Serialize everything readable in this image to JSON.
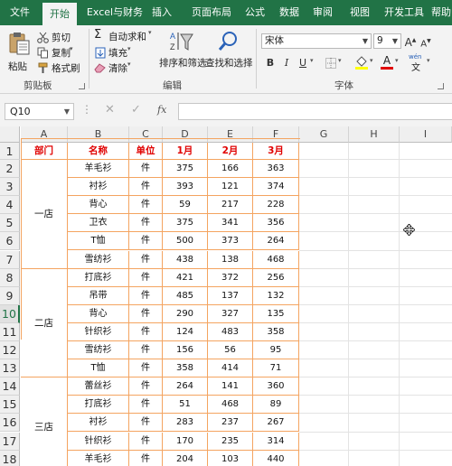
{
  "tabs": [
    "文件",
    "开始",
    "Excel与财务",
    "插入",
    "页面布局",
    "公式",
    "数据",
    "审阅",
    "视图",
    "开发工具",
    "帮助"
  ],
  "clipboard": {
    "paste": "粘贴",
    "cut": "剪切",
    "copy": "复制",
    "format_painter": "格式刷",
    "label": "剪贴板"
  },
  "editing": {
    "autosum": "自动求和",
    "fill": "填充",
    "clear": "清除",
    "sort_filter": "排序和筛选",
    "find_select": "查找和选择",
    "label": "编辑"
  },
  "font": {
    "name": "宋体",
    "size": "9",
    "bold": "B",
    "italic": "I",
    "underline": "U",
    "grow": "A",
    "shrink": "A",
    "font_color_letter": "A",
    "phonetic": "wén",
    "label": "字体"
  },
  "formula_bar": {
    "name_box": "Q10",
    "fx": "fx",
    "value": ""
  },
  "columns": [
    "A",
    "B",
    "C",
    "D",
    "E",
    "F",
    "G",
    "H",
    "I"
  ],
  "row_numbers": [
    "1",
    "2",
    "3",
    "4",
    "5",
    "6",
    "7",
    "8",
    "9",
    "10",
    "11",
    "12",
    "13",
    "14",
    "15",
    "16",
    "17",
    "18"
  ],
  "selected_row": "10",
  "table": {
    "headers": [
      "部门",
      "名称",
      "单位",
      "1月",
      "2月",
      "3月"
    ],
    "stores": [
      {
        "name": "一店",
        "rows": [
          [
            "羊毛衫",
            "件",
            "375",
            "166",
            "363"
          ],
          [
            "衬衫",
            "件",
            "393",
            "121",
            "374"
          ],
          [
            "背心",
            "件",
            "59",
            "217",
            "228"
          ],
          [
            "卫衣",
            "件",
            "375",
            "341",
            "356"
          ],
          [
            "T恤",
            "件",
            "500",
            "373",
            "264"
          ],
          [
            "雪纺衫",
            "件",
            "438",
            "138",
            "468"
          ]
        ]
      },
      {
        "name": "二店",
        "rows": [
          [
            "打底衫",
            "件",
            "421",
            "372",
            "256"
          ],
          [
            "吊带",
            "件",
            "485",
            "137",
            "132"
          ],
          [
            "背心",
            "件",
            "290",
            "327",
            "135"
          ],
          [
            "针织衫",
            "件",
            "124",
            "483",
            "358"
          ],
          [
            "雪纺衫",
            "件",
            "156",
            "56",
            "95"
          ],
          [
            "T恤",
            "件",
            "358",
            "414",
            "71"
          ]
        ]
      },
      {
        "name": "三店",
        "rows": [
          [
            "蕾丝衫",
            "件",
            "264",
            "141",
            "360"
          ],
          [
            "打底衫",
            "件",
            "51",
            "468",
            "89"
          ],
          [
            "衬衫",
            "件",
            "283",
            "237",
            "267"
          ],
          [
            "针织衫",
            "件",
            "170",
            "235",
            "314"
          ],
          [
            "羊毛衫",
            "件",
            "204",
            "103",
            "440"
          ]
        ]
      }
    ]
  },
  "colors": {
    "brand_green": "#217346",
    "table_border": "#f4a460",
    "header_text": "#e00000"
  },
  "icons": [
    "paste-icon",
    "scissors-icon",
    "copy-icon",
    "format-painter-icon",
    "sigma-icon",
    "fill-down-icon",
    "eraser-icon",
    "sort-filter-icon",
    "magnifier-icon",
    "cancel-icon",
    "check-icon",
    "fx-icon",
    "move-cursor-icon"
  ]
}
